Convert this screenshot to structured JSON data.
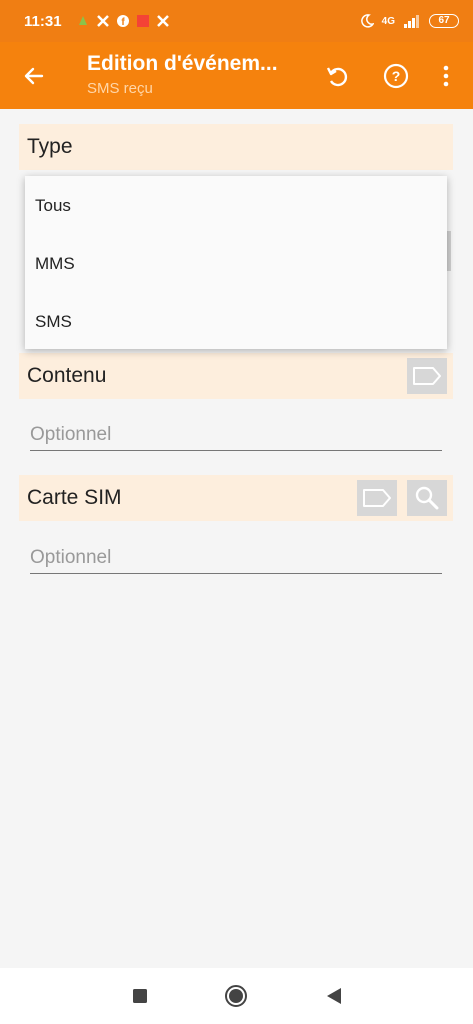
{
  "status_bar": {
    "time": "11:31",
    "network": "4G",
    "battery": "67"
  },
  "toolbar": {
    "title": "Edition d'événem...",
    "subtitle": "SMS reçu"
  },
  "sections": {
    "type_label": "Type",
    "contenu_label": "Contenu",
    "contenu_placeholder": "Optionnel",
    "carte_sim_label": "Carte SIM",
    "carte_sim_placeholder": "Optionnel"
  },
  "dropdown": {
    "options": [
      "Tous",
      "MMS",
      "SMS"
    ]
  },
  "colors": {
    "status_bar": "#f07e13",
    "toolbar": "#f5820d",
    "section_header": "#fdeedd",
    "icon_button": "#d7d7d7"
  }
}
